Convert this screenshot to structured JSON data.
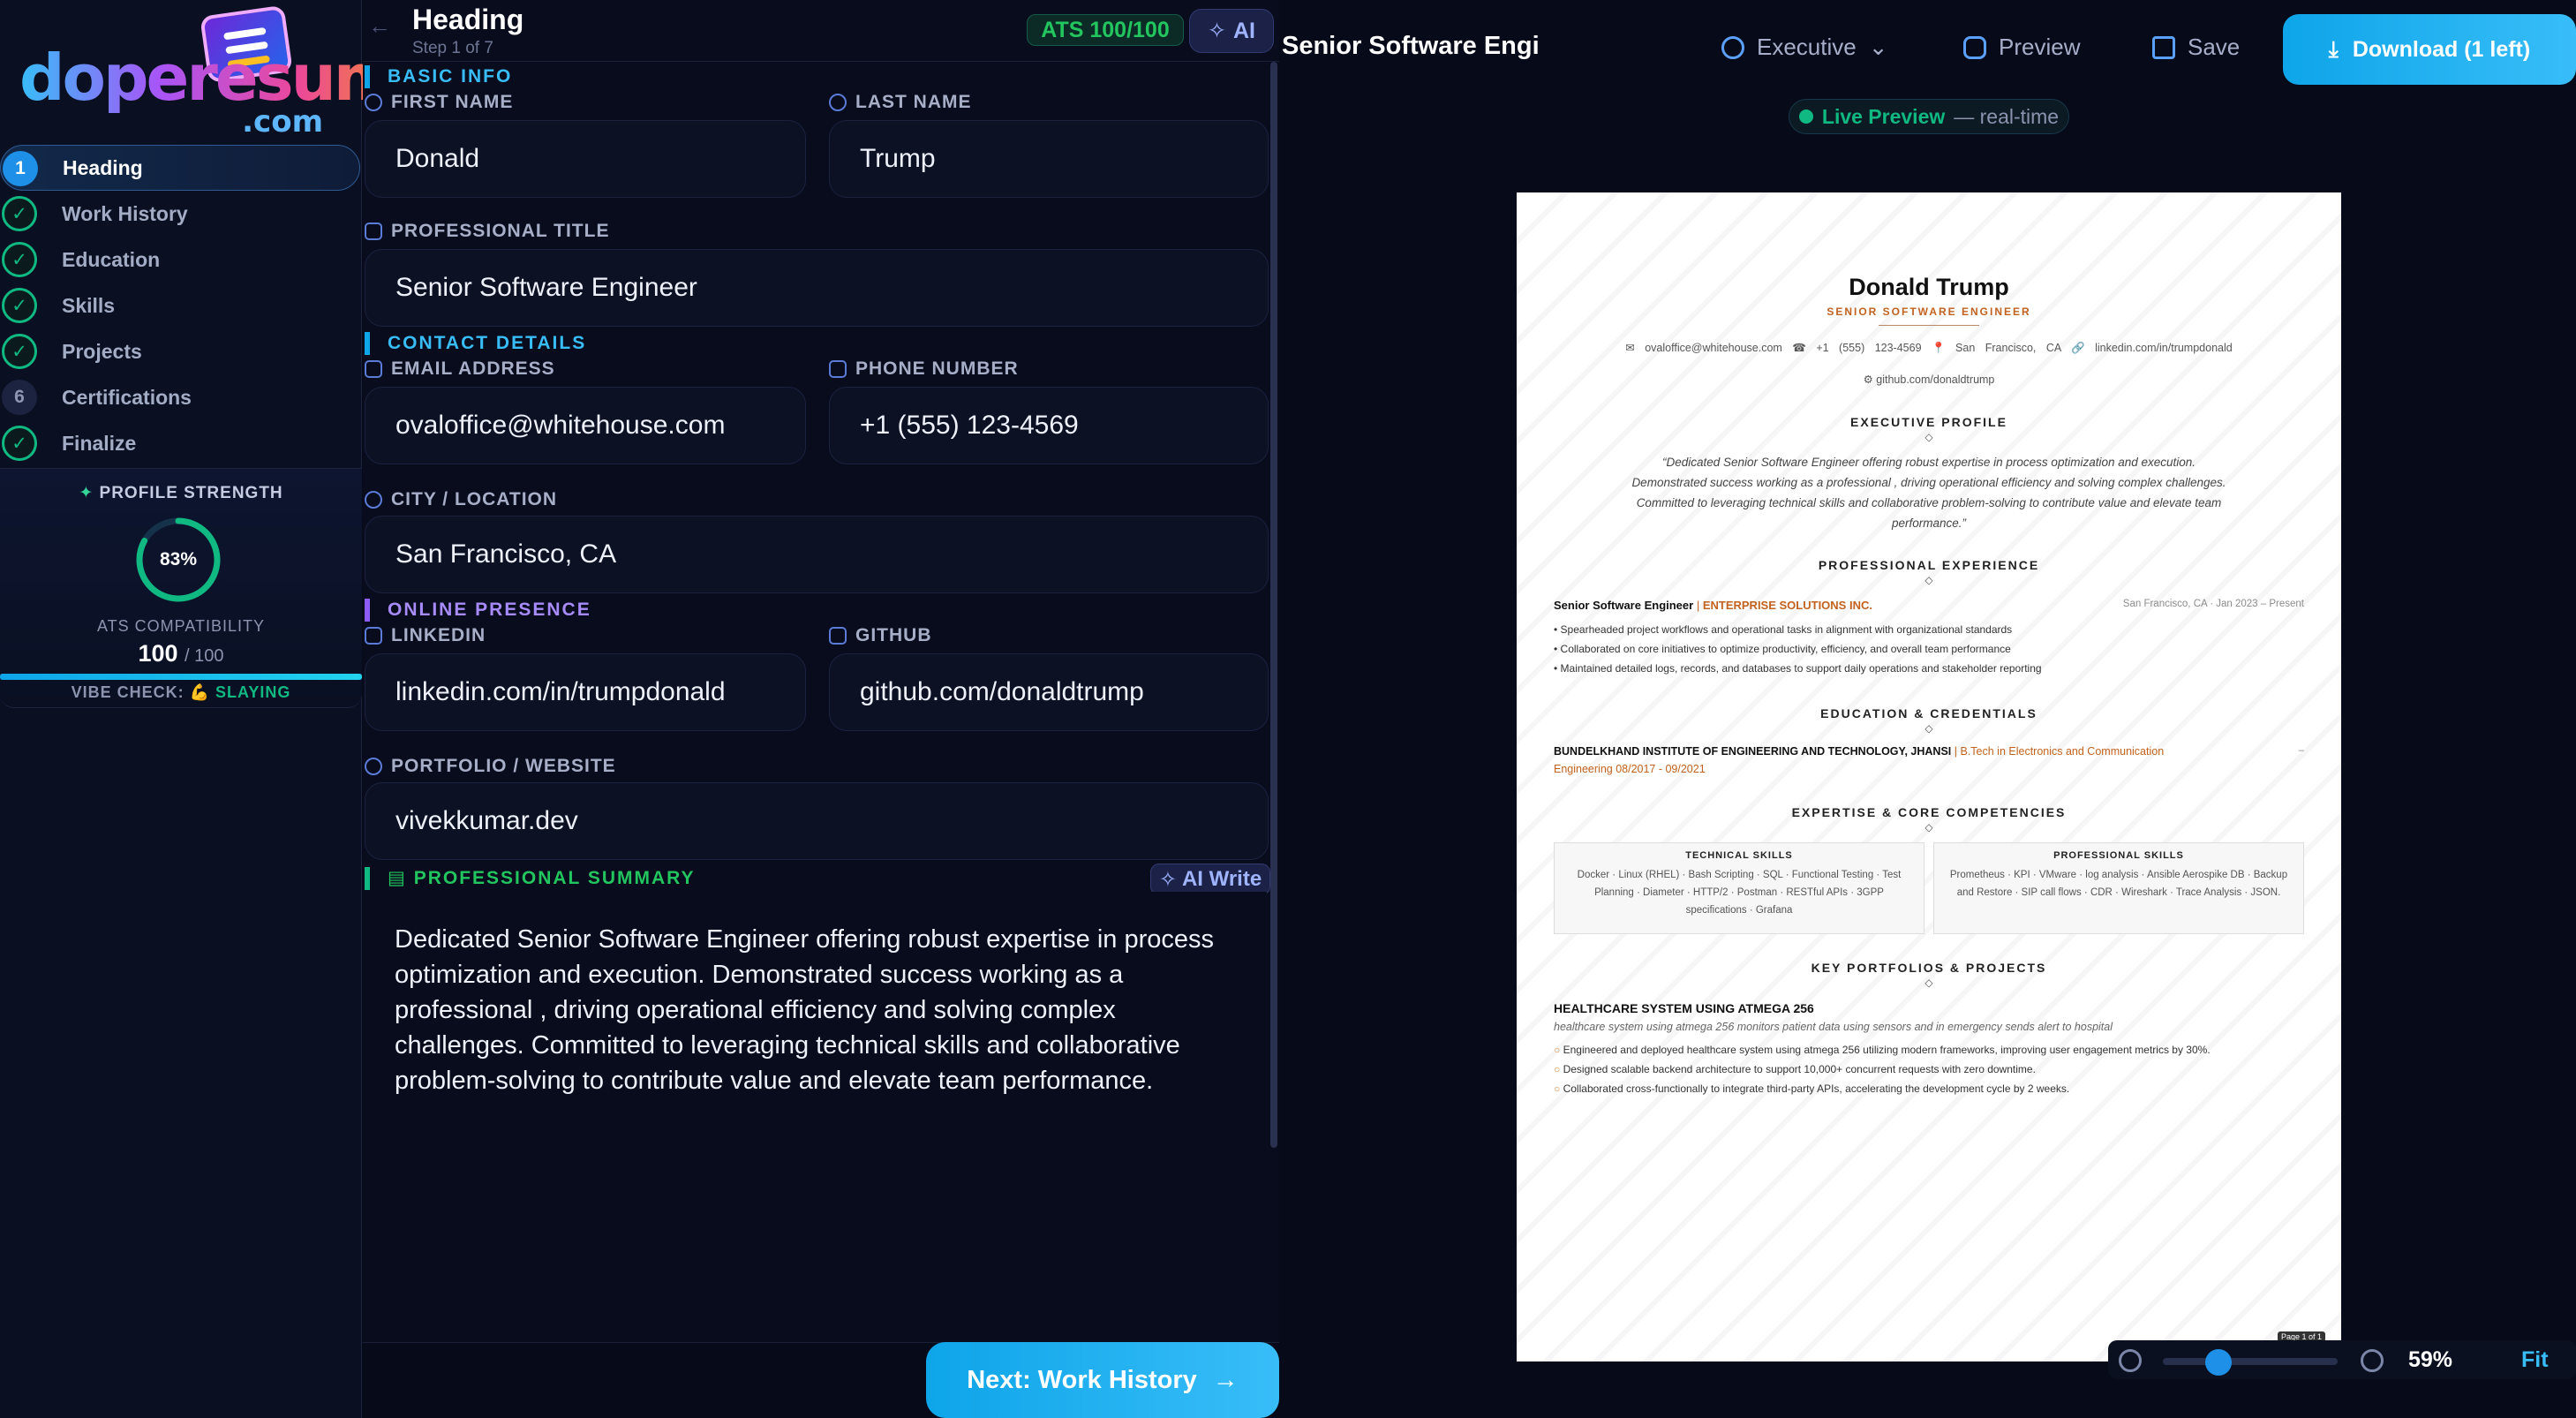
{
  "sidebar": {
    "brand": {
      "word": "doperesume",
      "suffix": ".com"
    },
    "steps": [
      {
        "num": "1",
        "label": "Heading",
        "state": "active"
      },
      {
        "num": "✓",
        "label": "Work History",
        "state": "done"
      },
      {
        "num": "✓",
        "label": "Education",
        "state": "done"
      },
      {
        "num": "✓",
        "label": "Skills",
        "state": "done"
      },
      {
        "num": "✓",
        "label": "Projects",
        "state": "done"
      },
      {
        "num": "6",
        "label": "Certifications",
        "state": "pending"
      },
      {
        "num": "✓",
        "label": "Finalize",
        "state": "done"
      }
    ],
    "strength": {
      "title": "PROFILE STRENGTH",
      "percent_label": "83%",
      "percent_value": 83,
      "ats_label": "ATS COMPATIBILITY",
      "ats_score": "100",
      "ats_max": "/ 100",
      "ats_fill": 1.0,
      "vibe_label": "VIBE CHECK:",
      "vibe_value": "💪 SLAYING"
    }
  },
  "editor": {
    "title": "Heading",
    "subtitle": "Step 1 of 7",
    "ats_badge": "ATS 100/100",
    "ai_button": "AI",
    "sections": {
      "basic": "BASIC INFO",
      "contact": "CONTACT DETAILS",
      "online": "ONLINE PRESENCE",
      "summary": "PROFESSIONAL SUMMARY"
    },
    "labels": {
      "first_name": "FIRST NAME",
      "last_name": "LAST NAME",
      "title": "PROFESSIONAL TITLE",
      "email": "EMAIL ADDRESS",
      "phone": "PHONE NUMBER",
      "city": "CITY / LOCATION",
      "linkedin": "LINKEDIN",
      "github": "GITHUB",
      "portfolio": "PORTFOLIO / WEBSITE"
    },
    "values": {
      "first_name": "Donald",
      "last_name": "Trump",
      "title": "Senior Software Engineer",
      "email": "ovaloffice@whitehouse.com",
      "phone": "+1 (555) 123-4569",
      "city": "San Francisco, CA",
      "linkedin": "linkedin.com/in/trumpdonald",
      "github": "github.com/donaldtrump",
      "portfolio": "vivekkumar.dev",
      "summary": "Dedicated Senior Software Engineer offering robust expertise in process optimization and execution. Demonstrated success working as a professional , driving operational efficiency and solving complex challenges. Committed to leveraging technical skills and collaborative problem-solving to contribute value and elevate team performance."
    },
    "ai_write": "AI Write",
    "next_button": "Next: Work History"
  },
  "preview": {
    "doc_title": "Senior Software Engine",
    "template": "Executive",
    "preview_label": "Preview",
    "save_label": "Save",
    "download_label": "Download (1 left)",
    "live_label": "Live Preview",
    "live_sub": "— real-time",
    "zoom": "59%",
    "zoom_fill": 0.59,
    "fit_label": "Fit",
    "page_label": "Page 1 of 1",
    "resume": {
      "name": "Donald Trump",
      "role": "SENIOR SOFTWARE ENGINEER",
      "contact": "✉ ovaloffice@whitehouse.com   ☎ +1 (555) 123-4569   📍 San Francisco, CA   🔗 linkedin.com/in/trumpdonald",
      "contact2": "⚙ github.com/donaldtrump",
      "sec_profile": "EXECUTIVE PROFILE",
      "profile": "“Dedicated Senior Software Engineer offering robust expertise in process optimization and execution. Demonstrated success working as a professional , driving operational efficiency and solving complex challenges. Committed to leveraging technical skills and collaborative problem-solving to contribute value and elevate team performance.”",
      "sec_experience": "PROFESSIONAL EXPERIENCE",
      "job_title": "Senior Software Engineer",
      "job_org": "ENTERPRISE SOLUTIONS INC.",
      "job_meta": "San Francisco, CA · Jan 2023 – Present",
      "job_bullets": [
        "Spearheaded project workflows and operational tasks in alignment with organizational standards",
        "Collaborated on core initiatives to optimize productivity, efficiency, and overall team performance",
        "Maintained detailed logs, records, and databases to support daily operations and stakeholder reporting"
      ],
      "sec_education": "EDUCATION & CREDENTIALS",
      "edu_school": "BUNDELKHAND INSTITUTE OF ENGINEERING AND TECHNOLOGY, JHANSI",
      "edu_degree": "B.Tech in Electronics and Communication",
      "edu_line2": "Engineering 08/2017 - 09/2021",
      "edu_meta": "–",
      "sec_skills": "EXPERTISE & CORE COMPETENCIES",
      "tech_title": "TECHNICAL SKILLS",
      "tech_skills": "Docker · Linux (RHEL) · Bash Scripting · SQL · Functional Testing · Test Planning · Diameter · HTTP/2 · Postman · RESTful APIs · 3GPP specifications · Grafana",
      "prof_title": "PROFESSIONAL SKILLS",
      "prof_skills": "Prometheus · KPI · VMware · log analysis · Ansible Aerospike DB · Backup and Restore · SIP call flows · CDR · Wireshark · Trace Analysis · JSON.",
      "sec_projects": "KEY PORTFOLIOS & PROJECTS",
      "proj_title": "HEALTHCARE SYSTEM USING ATMEGA 256",
      "proj_desc": "healthcare system using atmega 256 monitors patient data using sensors and in emergency sends alert to hospital",
      "proj_bullets": [
        "Engineered and deployed healthcare system using atmega 256 utilizing modern frameworks, improving user engagement metrics by 30%.",
        "Designed scalable backend architecture to support 10,000+ concurrent requests with zero downtime.",
        "Collaborated cross-functionally to integrate third-party APIs, accelerating the development cycle by 2 weeks."
      ]
    }
  },
  "colors": {
    "accent": "#0ea5e9",
    "success": "#10b981",
    "brand_orange": "#c2621e",
    "background": "#070a18"
  }
}
